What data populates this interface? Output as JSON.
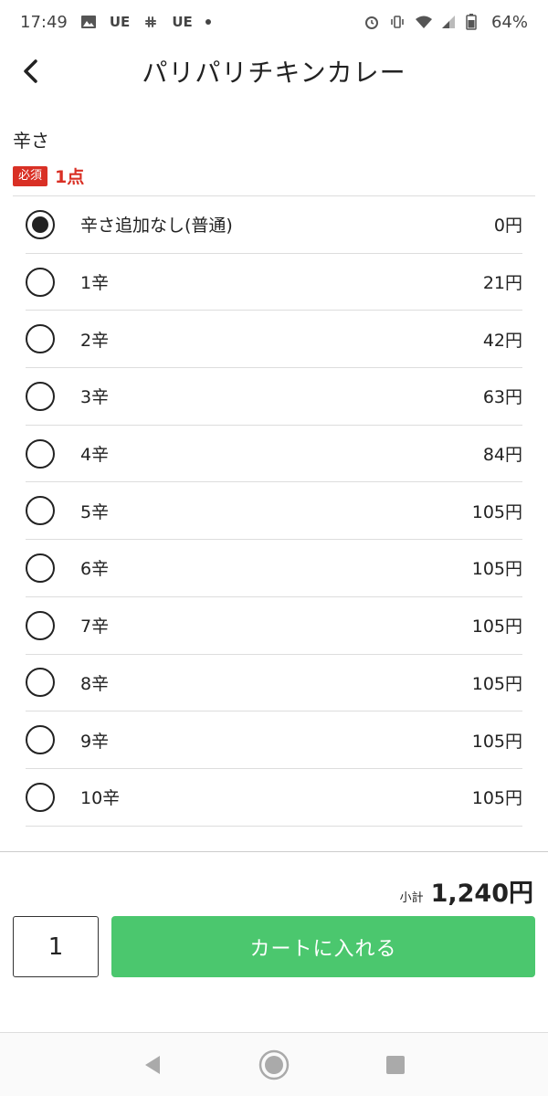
{
  "status_bar": {
    "time": "17:49",
    "notif_text_1": "UE",
    "notif_text_2": "UE",
    "battery": "64%"
  },
  "header": {
    "title": "パリパリチキンカレー"
  },
  "section": {
    "title": "辛さ",
    "required_badge": "必須",
    "required_count": "1点"
  },
  "options": [
    {
      "label": "辛さ追加なし(普通)",
      "price": "0円",
      "selected": true
    },
    {
      "label": "1辛",
      "price": "21円",
      "selected": false
    },
    {
      "label": "2辛",
      "price": "42円",
      "selected": false
    },
    {
      "label": "3辛",
      "price": "63円",
      "selected": false
    },
    {
      "label": "4辛",
      "price": "84円",
      "selected": false
    },
    {
      "label": "5辛",
      "price": "105円",
      "selected": false
    },
    {
      "label": "6辛",
      "price": "105円",
      "selected": false
    },
    {
      "label": "7辛",
      "price": "105円",
      "selected": false
    },
    {
      "label": "8辛",
      "price": "105円",
      "selected": false
    },
    {
      "label": "9辛",
      "price": "105円",
      "selected": false
    },
    {
      "label": "10辛",
      "price": "105円",
      "selected": false
    }
  ],
  "subtotal": {
    "label": "小計",
    "value": "1,240円"
  },
  "quantity": "1",
  "cart_button_label": "カートに入れる",
  "colors": {
    "accent_green": "#4bc76e",
    "required_red": "#d93025"
  }
}
